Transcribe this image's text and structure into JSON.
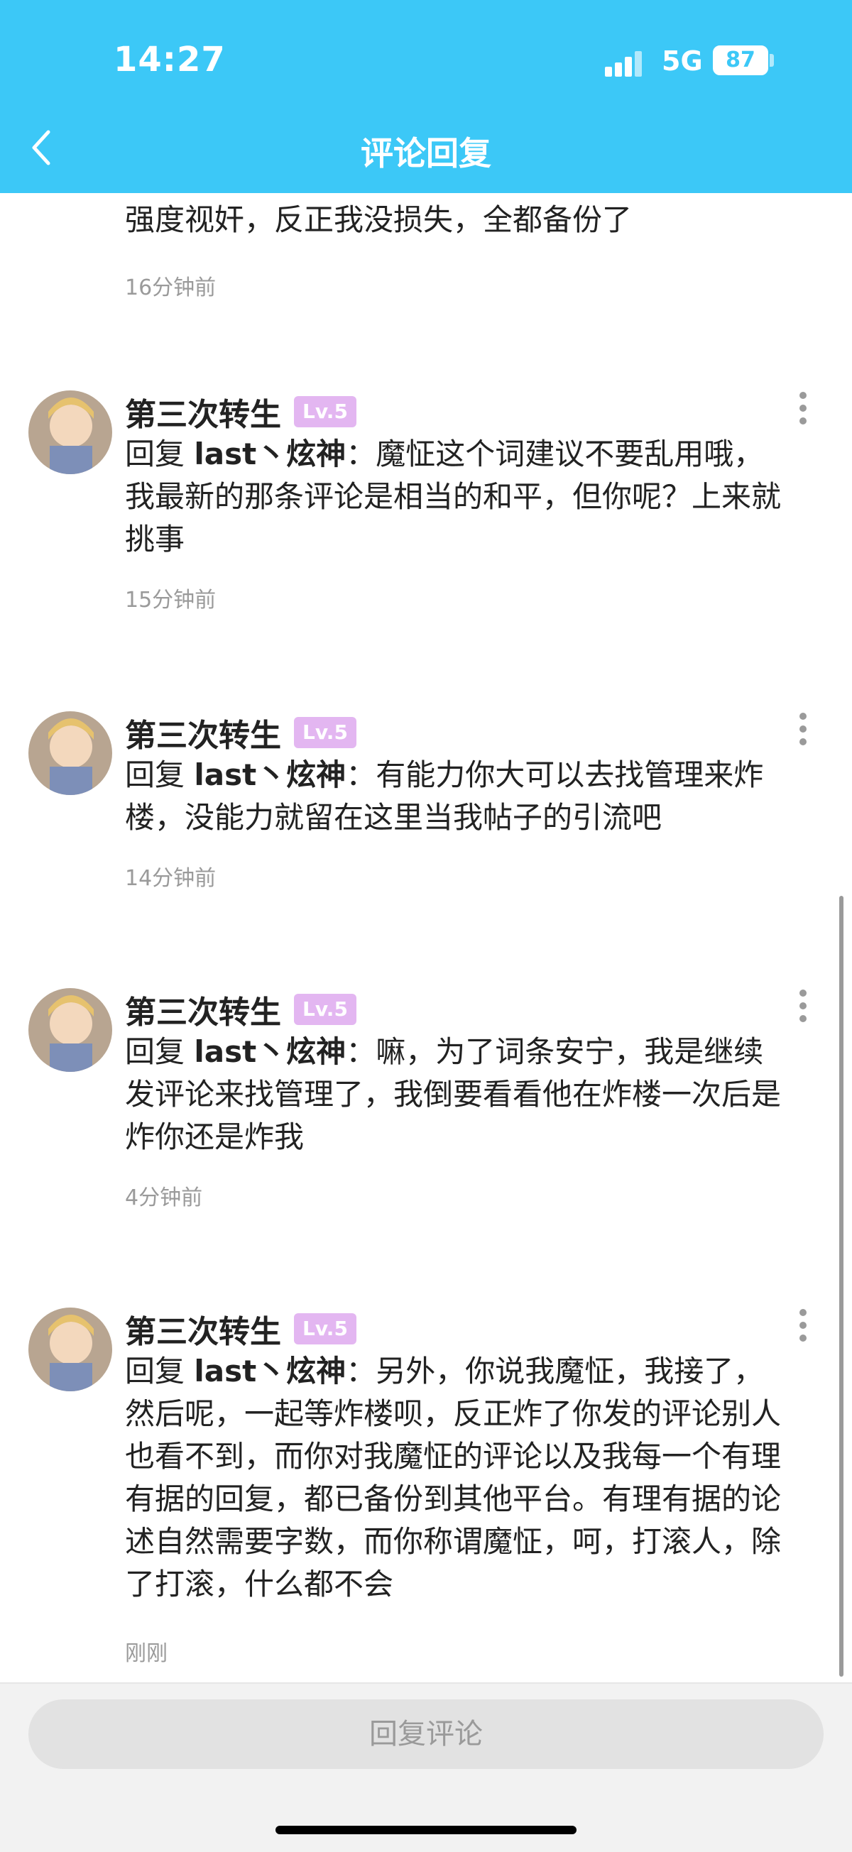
{
  "status_bar": {
    "time": "14:27",
    "network": "5G",
    "battery": "87"
  },
  "header": {
    "title": "评论回复",
    "back_icon": "chevron-left-icon"
  },
  "partial_comment": {
    "text": "强度视奸，反正我没损失，全都备份了",
    "time": "16分钟前"
  },
  "comments": [
    {
      "username": "第三次转生",
      "level": "Lv.5",
      "reply_prefix": "回复 ",
      "reply_target": "last丶炫神",
      "text": "：魔怔这个词建议不要乱用哦，我最新的那条评论是相当的和平，但你呢？上来就挑事",
      "time": "15分钟前"
    },
    {
      "username": "第三次转生",
      "level": "Lv.5",
      "reply_prefix": "回复 ",
      "reply_target": "last丶炫神",
      "text": "：有能力你大可以去找管理来炸楼，没能力就留在这里当我帖子的引流吧",
      "time": "14分钟前"
    },
    {
      "username": "第三次转生",
      "level": "Lv.5",
      "reply_prefix": "回复 ",
      "reply_target": "last丶炫神",
      "text": "：嘛，为了词条安宁，我是继续发评论来找管理了，我倒要看看他在炸楼一次后是炸你还是炸我",
      "time": "4分钟前"
    },
    {
      "username": "第三次转生",
      "level": "Lv.5",
      "reply_prefix": "回复 ",
      "reply_target": "last丶炫神",
      "text": "：另外，你说我魔怔，我接了，然后呢，一起等炸楼呗，反正炸了你发的评论别人也看不到，而你对我魔怔的评论以及我每一个有理有据的回复，都已备份到其他平台。有理有据的论述自然需要字数，而你称谓魔怔，呵，打滚人，除了打滚，什么都不会",
      "time": "刚刚"
    }
  ],
  "bottom_bar": {
    "reply_button": "回复评论"
  },
  "colors": {
    "header": "#3cc8f7",
    "level_badge": "#e3b6f1",
    "timestamp": "#9a9a9a"
  }
}
